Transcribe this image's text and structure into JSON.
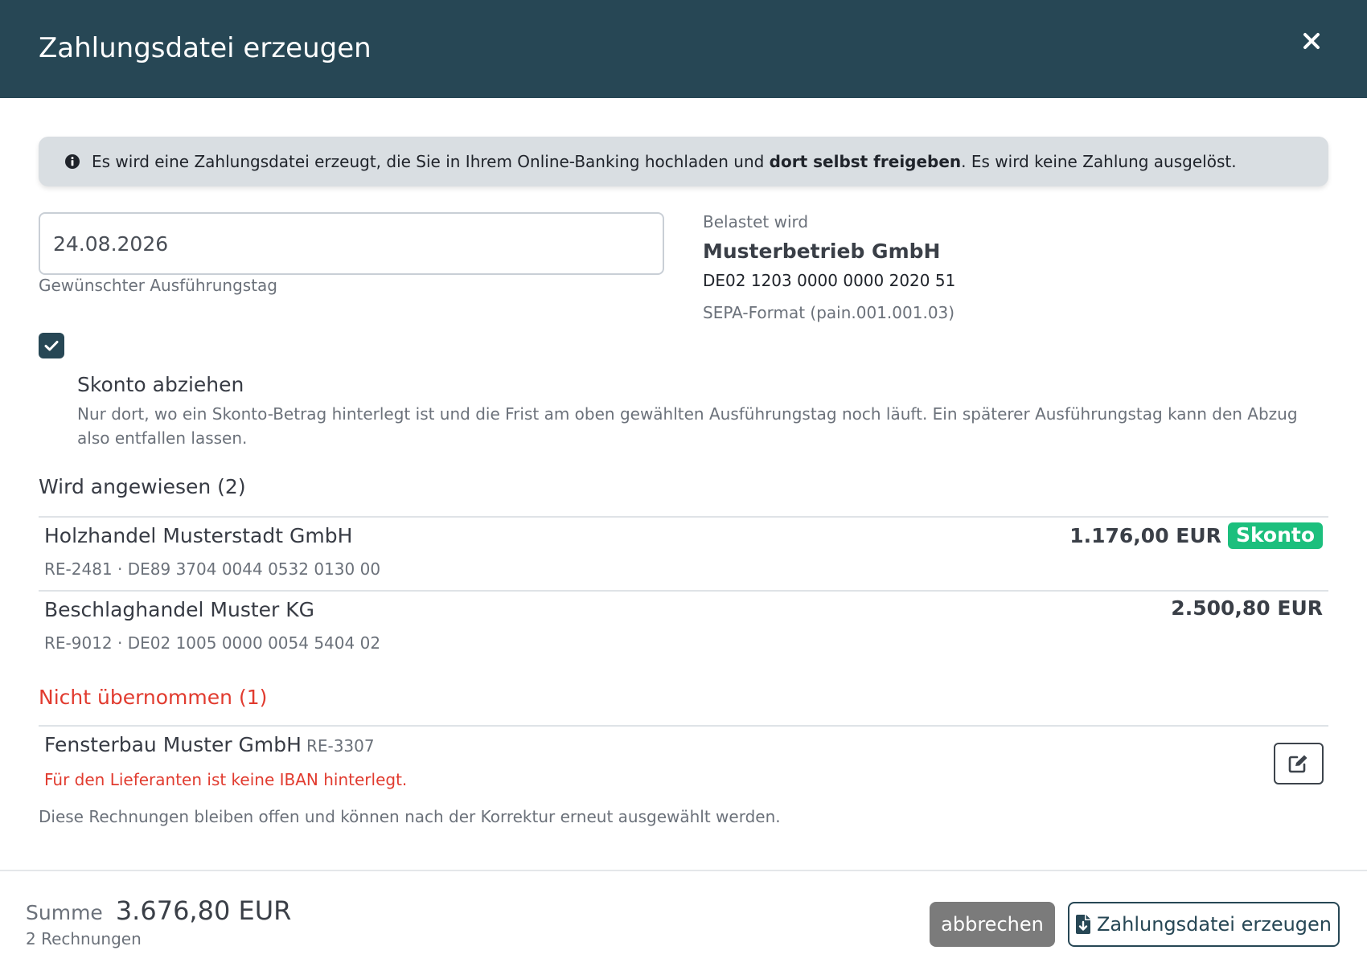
{
  "dialog": {
    "title": "Zahlungsdatei erzeugen",
    "close_icon": "close-icon"
  },
  "info": {
    "icon": "info-icon",
    "text_before": "Es wird eine Zahlungsdatei erzeugt, die Sie in Ihrem Online-Banking hochladen und ",
    "text_bold": "dort selbst freigeben",
    "text_after": ". Es wird keine Zahlung ausgelöst."
  },
  "execution_date": {
    "value": "24.08.2026",
    "help": "Gewünschter Ausführungstag"
  },
  "debit": {
    "label": "Belastet wird",
    "company": "Musterbetrieb GmbH",
    "iban": "DE02 1203 0000 0000 2020 51",
    "format": "SEPA-Format (pain.001.001.03)"
  },
  "skonto": {
    "checked": true,
    "title": "Skonto abziehen",
    "description": "Nur dort, wo ein Skonto-Betrag hinterlegt ist und die Frist am oben gewählten Ausführungstag noch läuft. Ein späterer Ausführungstag kann den Abzug also entfallen lassen."
  },
  "transferred": {
    "title": "Wird angewiesen (2)",
    "items": [
      {
        "name": "Holzhandel Musterstadt GmbH",
        "meta": "RE-2481 · DE89 3704 0044 0532 0130 00",
        "amount": "1.176,00 EUR",
        "badge": "Skonto"
      },
      {
        "name": "Beschlaghandel Muster KG",
        "meta": "RE-9012 · DE02 1005 0000 0054 5404 02",
        "amount": "2.500,80 EUR"
      }
    ]
  },
  "not_transferred": {
    "title": "Nicht übernommen (1)",
    "items": [
      {
        "name": "Fensterbau Muster GmbH",
        "ref": "RE-3307",
        "error": "Für den Lieferanten ist keine IBAN hinterlegt."
      }
    ],
    "note": "Diese Rechnungen bleiben offen und können nach der Korrektur erneut ausgewählt werden."
  },
  "footer": {
    "sum_label": "Summe",
    "sum_value": "3.676,80 EUR",
    "count": "2 Rechnungen",
    "cancel_label": "abbrechen",
    "submit_label": "Zahlungsdatei erzeugen"
  },
  "colors": {
    "header_bg": "#274755",
    "info_bg": "#d9dee2",
    "badge_green": "#1cbf7d",
    "error_red": "#e13b2f",
    "cancel_gray": "#7b7b7b"
  }
}
